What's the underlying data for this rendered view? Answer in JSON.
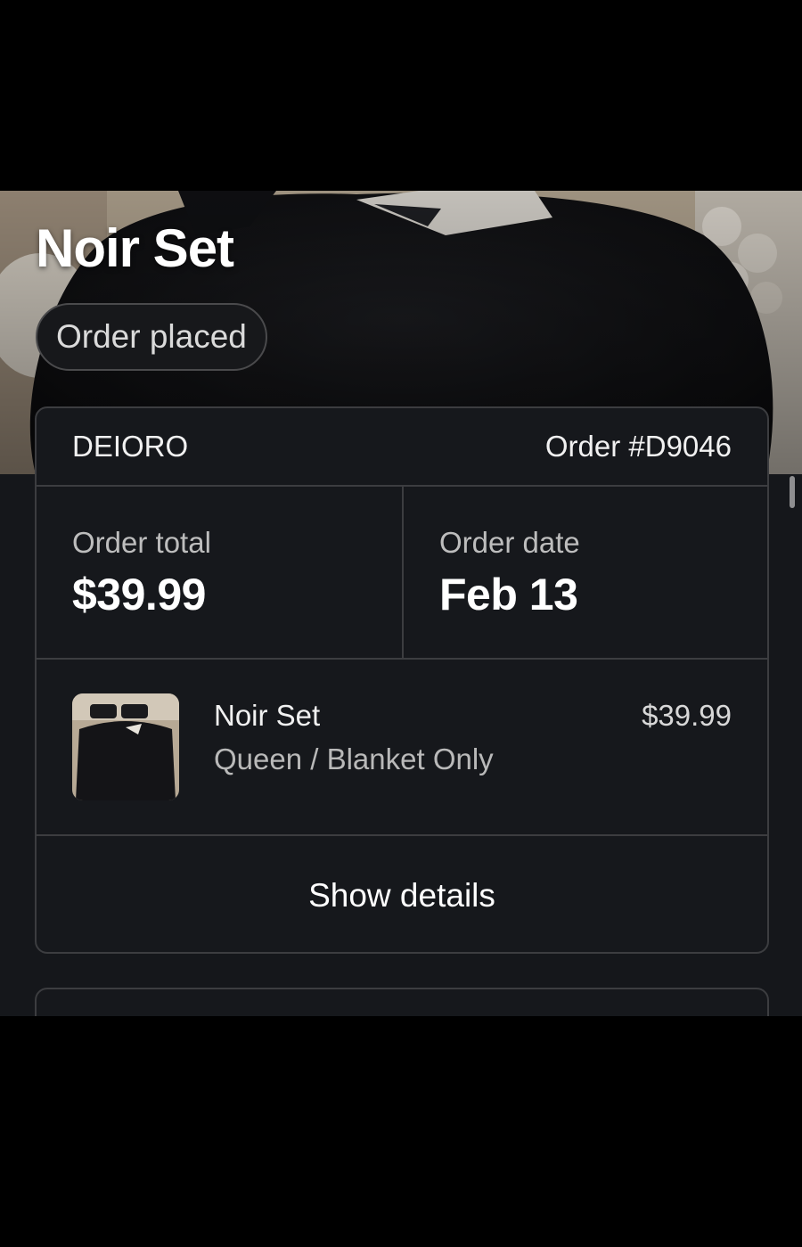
{
  "product": {
    "title": "Noir Set",
    "status": "Order placed",
    "hero_image": "black-fluffy-bedding-photo"
  },
  "order": {
    "merchant": "DEIORO",
    "order_number": "Order #D9046",
    "total_label": "Order total",
    "total_value": "$39.99",
    "date_label": "Order date",
    "date_value": "Feb 13"
  },
  "item": {
    "name": "Noir Set",
    "variant": "Queen / Blanket Only",
    "price": "$39.99",
    "thumbnail": "black-bedding-thumbnail"
  },
  "actions": {
    "show_details": "Show details"
  },
  "colors": {
    "background": "#15171b",
    "card_border": "#3c3d40",
    "text_primary": "#ffffff",
    "text_secondary": "#bdbdbd"
  }
}
